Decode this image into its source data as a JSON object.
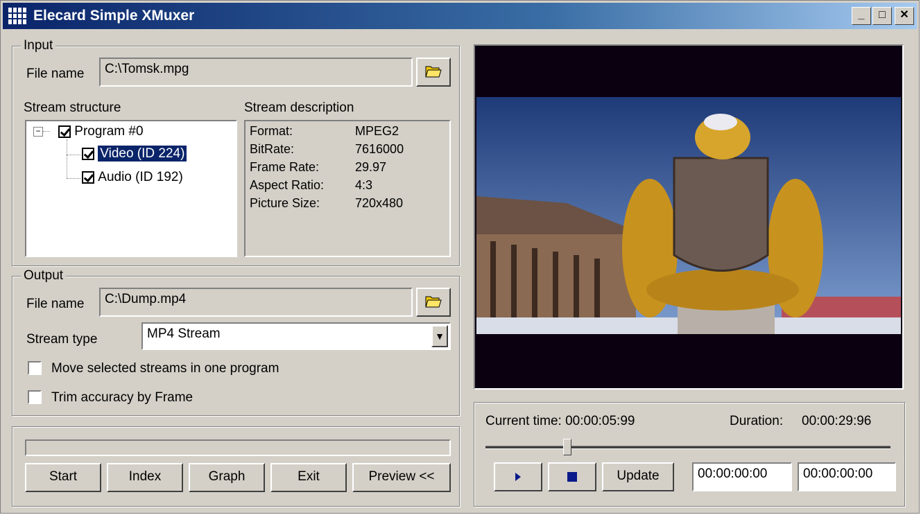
{
  "window": {
    "title": "Elecard Simple XMuxer"
  },
  "input": {
    "legend": "Input",
    "file_label": "File name",
    "file_value": "C:\\Tomsk.mpg",
    "structure_label": "Stream structure",
    "description_label": "Stream description",
    "tree": {
      "program": "Program #0",
      "video": "Video (ID 224)",
      "audio": "Audio (ID 192)"
    },
    "description": {
      "format_key": "Format:",
      "format_val": "MPEG2",
      "bitrate_key": "BitRate:",
      "bitrate_val": "7616000",
      "framerate_key": "Frame Rate:",
      "framerate_val": "29.97",
      "aspect_key": "Aspect Ratio:",
      "aspect_val": "4:3",
      "size_key": "Picture Size:",
      "size_val": "720x480"
    }
  },
  "output": {
    "legend": "Output",
    "file_label": "File name",
    "file_value": "C:\\Dump.mp4",
    "stream_type_label": "Stream type",
    "stream_type_value": "MP4 Stream",
    "move_streams_label": "Move selected streams in one program",
    "trim_label": "Trim accuracy by Frame"
  },
  "actions": {
    "start": "Start",
    "index": "Index",
    "graph": "Graph",
    "exit": "Exit",
    "preview": "Preview <<"
  },
  "player": {
    "current_time_label": "Current time: 00:00:05:99",
    "duration_label": "Duration:",
    "duration_value": "00:00:29:96",
    "update": "Update",
    "time_start": "00:00:00:00",
    "time_end": "00:00:00:00",
    "seek_fraction": 0.2
  }
}
